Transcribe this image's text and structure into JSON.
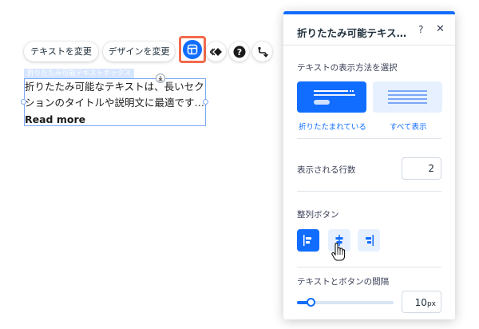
{
  "toolbar": {
    "change_text_label": "テキストを変更",
    "change_design_label": "デザインを変更"
  },
  "canvas": {
    "selection_tag": "折りたたみ可能テキストボックス",
    "text_line1": "折りたたみ可能なテキストは、長いセク",
    "text_line2": "ションのタイトルや説明文に最適です…",
    "read_more": "Read more"
  },
  "panel": {
    "title": "折りたたみ可能テキス…",
    "help": "?",
    "close": "✕",
    "display_section_label": "テキストの表示方法を選択",
    "display_options": [
      {
        "caption": "折りたたまれている",
        "selected": true
      },
      {
        "caption": "すべて表示",
        "selected": false
      }
    ],
    "lines_label": "表示される行数",
    "lines_value": "2",
    "align_section_label": "整列ボタン",
    "align_options": [
      "left",
      "center",
      "right"
    ],
    "align_selected": "left",
    "gap_label": "テキストとボタンの間隔",
    "gap_value": "10",
    "gap_unit": "px"
  },
  "colors": {
    "accent": "#116dff",
    "accent_light": "#e7f0ff",
    "highlight": "#f26a4c"
  },
  "icons": [
    "layout-icon",
    "animation-icon",
    "help-icon",
    "connect-icon",
    "drag-arrow-icon",
    "hand-cursor-icon"
  ]
}
